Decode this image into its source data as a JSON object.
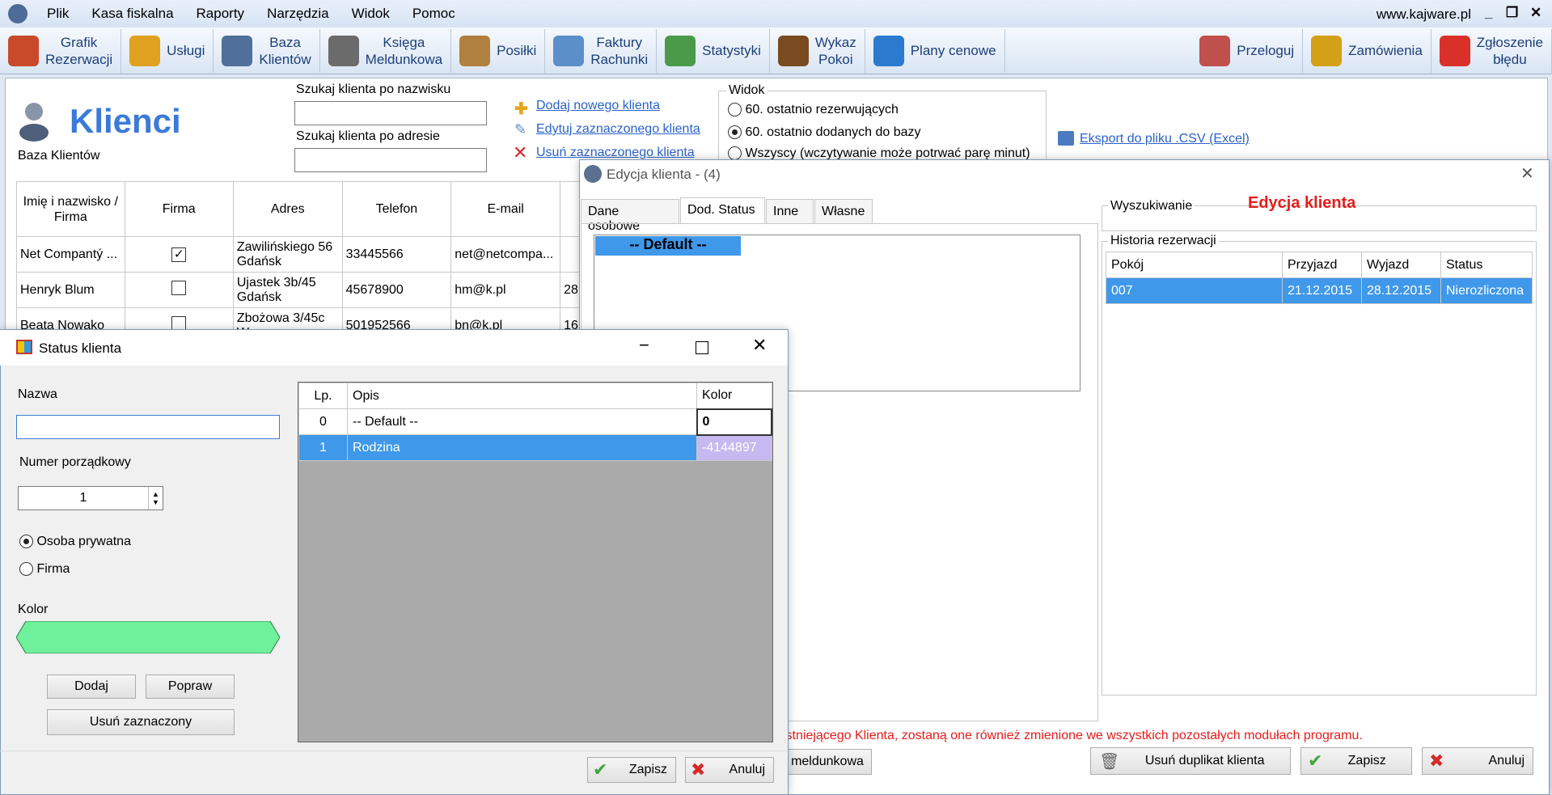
{
  "menu": {
    "items": [
      "Plik",
      "Kasa fiskalna",
      "Raporty",
      "Narzędzia",
      "Widok",
      "Pomoc"
    ],
    "site": "www.kajware.pl"
  },
  "toolbar": [
    {
      "l1": "Grafik",
      "l2": "Rezerwacji",
      "icon": "calendar-icon",
      "color": "#c94a2a"
    },
    {
      "l1": "Usługi",
      "l2": "",
      "icon": "broom-icon",
      "color": "#e0a020"
    },
    {
      "l1": "Baza",
      "l2": "Klientów",
      "icon": "user-icon",
      "color": "#506f9a"
    },
    {
      "l1": "Księga",
      "l2": "Meldunkowa",
      "icon": "book-icon",
      "color": "#6b6b6b"
    },
    {
      "l1": "Posiłki",
      "l2": "",
      "icon": "food-icon",
      "color": "#b08040"
    },
    {
      "l1": "Faktury",
      "l2": "Rachunki",
      "icon": "invoice-icon",
      "color": "#5a8fc9"
    },
    {
      "l1": "Statystyki",
      "l2": "",
      "icon": "chart-icon",
      "color": "#4a9a4a"
    },
    {
      "l1": "Wykaz",
      "l2": "Pokoi",
      "icon": "door-icon",
      "color": "#7a4a20"
    },
    {
      "l1": "Plany cenowe",
      "l2": "",
      "icon": "price-chart-icon",
      "color": "#2a7ad0"
    }
  ],
  "toolbar_right": [
    {
      "l1": "Przeloguj",
      "l2": "",
      "icon": "users-icon",
      "color": "#c0504d"
    },
    {
      "l1": "Zamówienia",
      "l2": "",
      "icon": "coins-icon",
      "color": "#d4a017"
    },
    {
      "l1": "Zgłoszenie",
      "l2": "błędu",
      "icon": "error-icon",
      "color": "#d9302a"
    }
  ],
  "clients": {
    "title": "Klienci",
    "subtitle": "Baza Klientów",
    "search_name_label": "Szukaj klienta po nazwisku",
    "search_addr_label": "Szukaj klienta po adresie",
    "add_link": "Dodaj nowego klienta",
    "edit_link": "Edytuj zaznaczonego klienta",
    "delete_link": "Usuń zaznaczonego klienta",
    "view_label": "Widok",
    "view_options": [
      "60. ostatnio rezerwujących",
      "60. ostatnio dodanych do bazy",
      "Wszyscy (wczytywanie może potrwać parę minut)"
    ],
    "export_link": "Eksport do pliku .CSV (Excel)",
    "columns": [
      "Imię i nazwisko / Firma",
      "Firma",
      "Adres",
      "Telefon",
      "E-mail"
    ],
    "rows": [
      {
        "name": "Net Compantý ...",
        "firma": true,
        "addr1": "Zawilińskiego 56",
        "addr2": "Gdańsk",
        "tel": "33445566",
        "email": "net@netcompa...",
        "extra": ""
      },
      {
        "name": "Henryk Blum",
        "firma": false,
        "addr1": "Ujastek 3b/45",
        "addr2": "Gdańsk",
        "tel": "45678900",
        "email": "hm@k.pl",
        "extra": "28"
      },
      {
        "name": "Beata Nowako",
        "firma": false,
        "addr1": "Zbożowa 3/45c",
        "addr2": "W",
        "tel": "501952566",
        "email": "bn@k.pl",
        "extra": "16"
      }
    ]
  },
  "edit": {
    "title": "Edycja klienta - (4)",
    "tabs": [
      "Dane osobowe",
      "Dod. Status",
      "Inne",
      "Własne"
    ],
    "status_default": "-- Default --",
    "search_label": "Wyszukiwanie",
    "heading": "Edycja klienta",
    "history_label": "Historia rezerwacji",
    "history_cols": [
      "Pokój",
      "Przyjazd",
      "Wyjazd",
      "Status"
    ],
    "history_rows": [
      [
        "007",
        "21.12.2015",
        "28.12.2015",
        "Nierozliczona"
      ]
    ],
    "warning": "istniejącego Klienta, zostaną one również zmienione we wszystkich pozostałych modułach programu.",
    "meld_button": "meldunkowa",
    "dup_button": "Usuń duplikat klienta",
    "save": "Zapisz",
    "cancel": "Anuluj"
  },
  "status": {
    "title": "Status klienta",
    "name_label": "Nazwa",
    "name_value": "",
    "order_label": "Numer porządkowy",
    "order_value": "1",
    "radio_private": "Osoba prywatna",
    "radio_company": "Firma",
    "color_label": "Kolor",
    "color_value": "#6ff09a",
    "add": "Dodaj",
    "fix": "Popraw",
    "remove": "Usuń zaznaczony",
    "cols": [
      "Lp.",
      "Opis",
      "Kolor"
    ],
    "rows": [
      [
        "0",
        "-- Default --",
        "0"
      ],
      [
        "1",
        "Rodzina",
        "-4144897"
      ]
    ],
    "save": "Zapisz",
    "cancel": "Anuluj"
  }
}
